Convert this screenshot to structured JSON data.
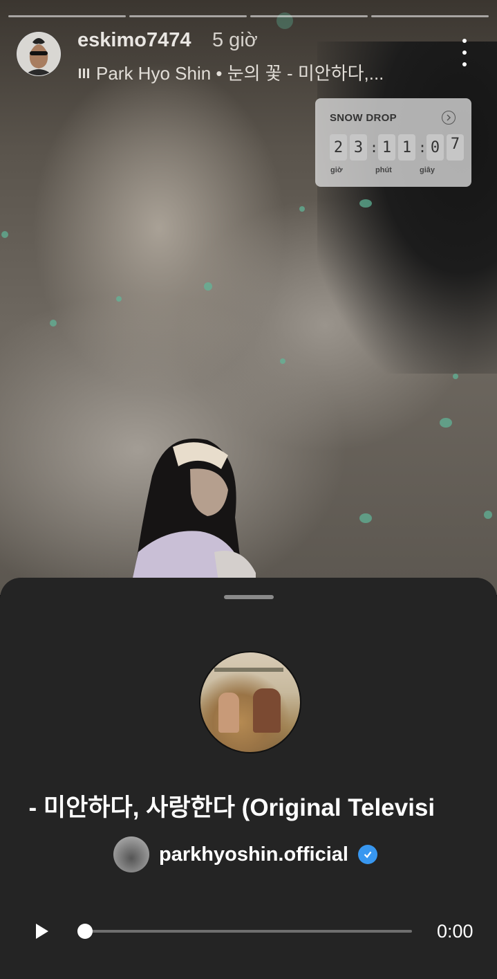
{
  "story": {
    "username": "eskimo7474",
    "time_ago": "5 giờ",
    "music_line": "Park Hyo Shin • 눈의 꽃 - 미안하다,..."
  },
  "countdown": {
    "title": "SNOW DROP",
    "digits": [
      "2",
      "3",
      "1",
      "1",
      "0",
      "7"
    ],
    "labels": {
      "hours": "giờ",
      "minutes": "phút",
      "seconds": "giây"
    }
  },
  "sheet": {
    "song_title": "¦ - 미안하다, 사랑한다 (Original Televisi",
    "artist": "parkhyoshin.official",
    "elapsed": "0:00",
    "progress_fraction": 0.0
  },
  "icons": {
    "music": "bars-icon",
    "more": "more-vertical-icon",
    "countdown_link": "chevron-right-circle-icon",
    "verified": "verified-badge-icon",
    "play": "play-icon"
  }
}
